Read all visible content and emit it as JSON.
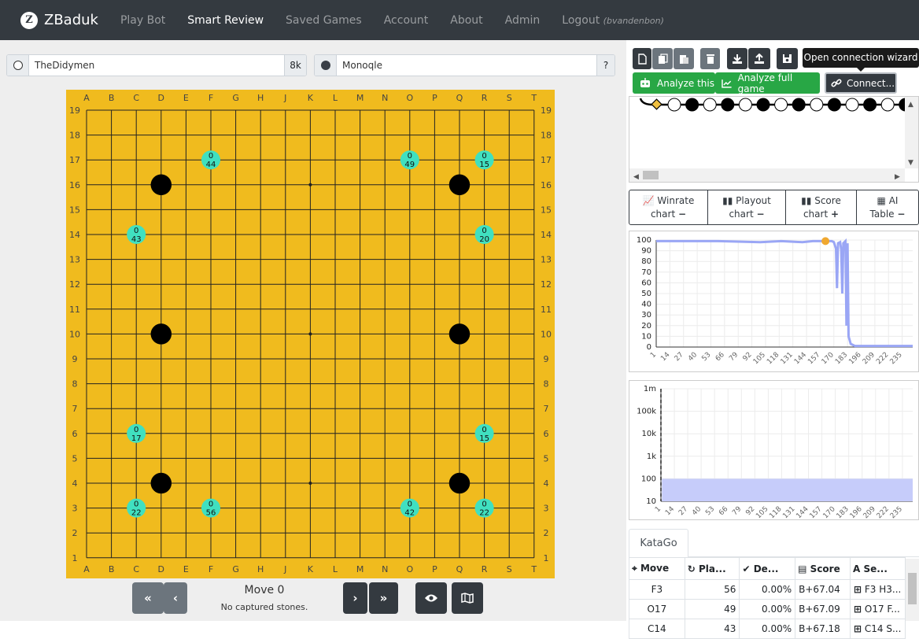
{
  "nav": {
    "brand": "ZBaduk",
    "logo_letter": "Z",
    "links": [
      "Play Bot",
      "Smart Review",
      "Saved Games",
      "Account",
      "About",
      "Admin"
    ],
    "logout": "Logout",
    "logout_user": "(bvandenbon)"
  },
  "players": {
    "white": {
      "name": "TheDidymen",
      "rank": "8k"
    },
    "black": {
      "name": "Monoqle",
      "rank": "?"
    }
  },
  "board": {
    "cols": [
      "A",
      "B",
      "C",
      "D",
      "E",
      "F",
      "G",
      "H",
      "J",
      "K",
      "L",
      "M",
      "N",
      "O",
      "P",
      "Q",
      "R",
      "S",
      "T"
    ],
    "rows": [
      "19",
      "18",
      "17",
      "16",
      "15",
      "14",
      "13",
      "12",
      "11",
      "10",
      "9",
      "8",
      "7",
      "6",
      "5",
      "4",
      "3",
      "2",
      "1"
    ],
    "stones": [
      {
        "color": "black",
        "pos": "D16"
      },
      {
        "color": "black",
        "pos": "Q16"
      },
      {
        "color": "black",
        "pos": "D10"
      },
      {
        "color": "black",
        "pos": "Q10"
      },
      {
        "color": "black",
        "pos": "D4"
      },
      {
        "color": "black",
        "pos": "Q4"
      }
    ],
    "hints": [
      {
        "pos": "F17",
        "top": "0",
        "bottom": "44"
      },
      {
        "pos": "O17",
        "top": "0",
        "bottom": "49"
      },
      {
        "pos": "R17",
        "top": "0",
        "bottom": "15"
      },
      {
        "pos": "C14",
        "top": "0",
        "bottom": "43"
      },
      {
        "pos": "R14",
        "top": "0",
        "bottom": "20"
      },
      {
        "pos": "C6",
        "top": "0",
        "bottom": "17"
      },
      {
        "pos": "R6",
        "top": "0",
        "bottom": "15"
      },
      {
        "pos": "C3",
        "top": "0",
        "bottom": "22"
      },
      {
        "pos": "F3",
        "top": "0",
        "bottom": "56"
      },
      {
        "pos": "O3",
        "top": "0",
        "bottom": "42"
      },
      {
        "pos": "R3",
        "top": "0",
        "bottom": "22"
      }
    ],
    "colors": {
      "wood": "#f0bb1e",
      "hint": "#40e0c0"
    }
  },
  "controls": {
    "move": "Move 0",
    "captured": "No captured stones.",
    "first": "«",
    "prev": "‹",
    "next": "›",
    "last": "»",
    "eye_icon": "eye-icon",
    "map_icon": "map-icon"
  },
  "toolbar": {
    "tooltip": "Open connection wizard",
    "analyze_this": "Analyze this",
    "analyze_full": "Analyze full game",
    "connect": "Connect..."
  },
  "chart_tabs": [
    {
      "line1": "Winrate",
      "line2": "chart",
      "toggle": "−"
    },
    {
      "line1": "Playout",
      "line2": "chart",
      "toggle": "−"
    },
    {
      "line1": "Score",
      "line2": "chart",
      "toggle": "+"
    },
    {
      "line1": "AI",
      "line2": "Table",
      "toggle": "−"
    }
  ],
  "chart_data": [
    {
      "type": "line",
      "title": "",
      "ylim": [
        0,
        100
      ],
      "yticks": [
        "100",
        "90",
        "80",
        "70",
        "60",
        "50",
        "40",
        "30",
        "20",
        "10",
        "0"
      ],
      "xticks": [
        "1",
        "14",
        "27",
        "40",
        "53",
        "66",
        "79",
        "92",
        "105",
        "118",
        "131",
        "144",
        "157",
        "170",
        "183",
        "196",
        "209",
        "222",
        "235"
      ],
      "xlim": [
        1,
        245
      ],
      "series": [
        {
          "color": "#9aa6f5",
          "x": [
            1,
            60,
            100,
            120,
            140,
            150,
            160,
            168,
            170,
            172,
            173,
            174,
            176,
            177,
            178,
            179,
            180,
            181,
            182,
            183,
            184,
            186,
            190,
            200,
            245
          ],
          "y": [
            99,
            99,
            98,
            99,
            98,
            99,
            99,
            99,
            98,
            92,
            55,
            97,
            98,
            91,
            50,
            97,
            98,
            99,
            20,
            97,
            10,
            3,
            1,
            1,
            1
          ]
        }
      ],
      "marker": {
        "x": 162,
        "y": 99,
        "color": "#f0a830"
      }
    },
    {
      "type": "bar",
      "title": "",
      "scale": "log",
      "yticks": [
        "1m",
        "100k",
        "10k",
        "1k",
        "100",
        "10"
      ],
      "xticks": [
        "1",
        "14",
        "27",
        "40",
        "53",
        "66",
        "79",
        "92",
        "105",
        "118",
        "131",
        "144",
        "157",
        "170",
        "183",
        "196",
        "209",
        "222",
        "235"
      ],
      "xlim": [
        1,
        245
      ],
      "values_level": 100,
      "series": [
        {
          "color": "#c6ccfa",
          "value": 100
        }
      ]
    }
  ],
  "katago": {
    "tab": "KataGo",
    "headers": [
      "Move",
      "Pla...",
      "De...",
      "Score",
      "Se..."
    ],
    "rows": [
      {
        "move": "F3",
        "playouts": "56",
        "delta": "0.00%",
        "score": "B+67.04",
        "seq": "F3 H3..."
      },
      {
        "move": "O17",
        "playouts": "49",
        "delta": "0.00%",
        "score": "B+67.09",
        "seq": "O17 F..."
      },
      {
        "move": "C14",
        "playouts": "43",
        "delta": "0.00%",
        "score": "B+67.18",
        "seq": "C14 S..."
      }
    ]
  }
}
